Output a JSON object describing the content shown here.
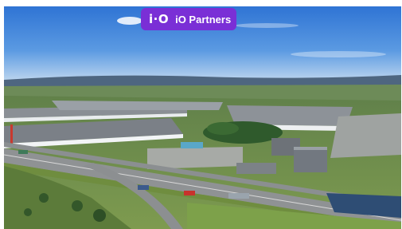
{
  "badge": {
    "logo_text": "i·O",
    "brand_name": "iO Partners",
    "color": "#7a2fd6"
  },
  "photo": {
    "subject": "aerial-logistics-park"
  }
}
